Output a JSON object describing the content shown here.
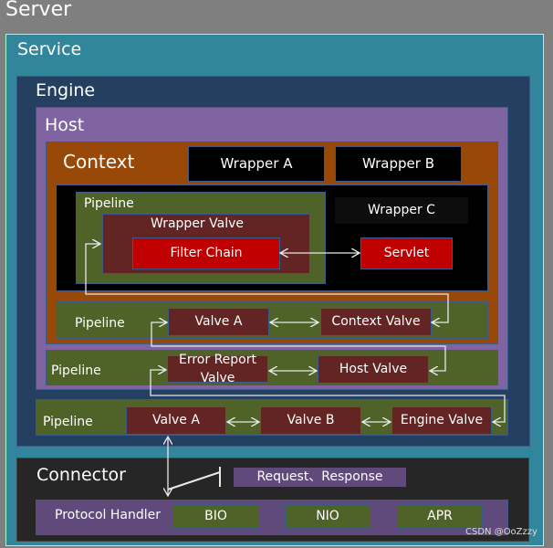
{
  "server": {
    "label": "Server"
  },
  "service": {
    "label": "Service"
  },
  "engine": {
    "label": "Engine",
    "pipeline": "Pipeline",
    "valves": [
      "Valve A",
      "Valve B",
      "Engine Valve"
    ]
  },
  "host": {
    "label": "Host",
    "pipeline": "Pipeline",
    "valves": [
      "Error Report Valve",
      "Host Valve"
    ]
  },
  "context": {
    "label": "Context",
    "pipeline": "Pipeline",
    "valves": [
      "Valve A",
      "Context Valve"
    ],
    "wrapper_a": "Wrapper A",
    "wrapper_b": "Wrapper B",
    "wrapper_c": {
      "label": "Wrapper C",
      "pipeline": "Pipeline",
      "wrapper_valve": "Wrapper Valve",
      "filter_chain": "Filter Chain",
      "servlet": "Servlet"
    }
  },
  "connector": {
    "label": "Connector",
    "request_response": "Request、Response",
    "protocol_handler": "Protocol Handler",
    "protocols": [
      "BIO",
      "NIO",
      "APR"
    ]
  },
  "watermark": "CSDN @OoZzzy",
  "colors": {
    "server": "#7f7f7f",
    "service": "#31869b",
    "engine": "#243f60",
    "host": "#8064a2",
    "context": "#984807",
    "pipeline": "#4f6228",
    "valve": "#632523",
    "filter": "#c00000",
    "connector": "#262626",
    "protocol": "#604a7b"
  }
}
